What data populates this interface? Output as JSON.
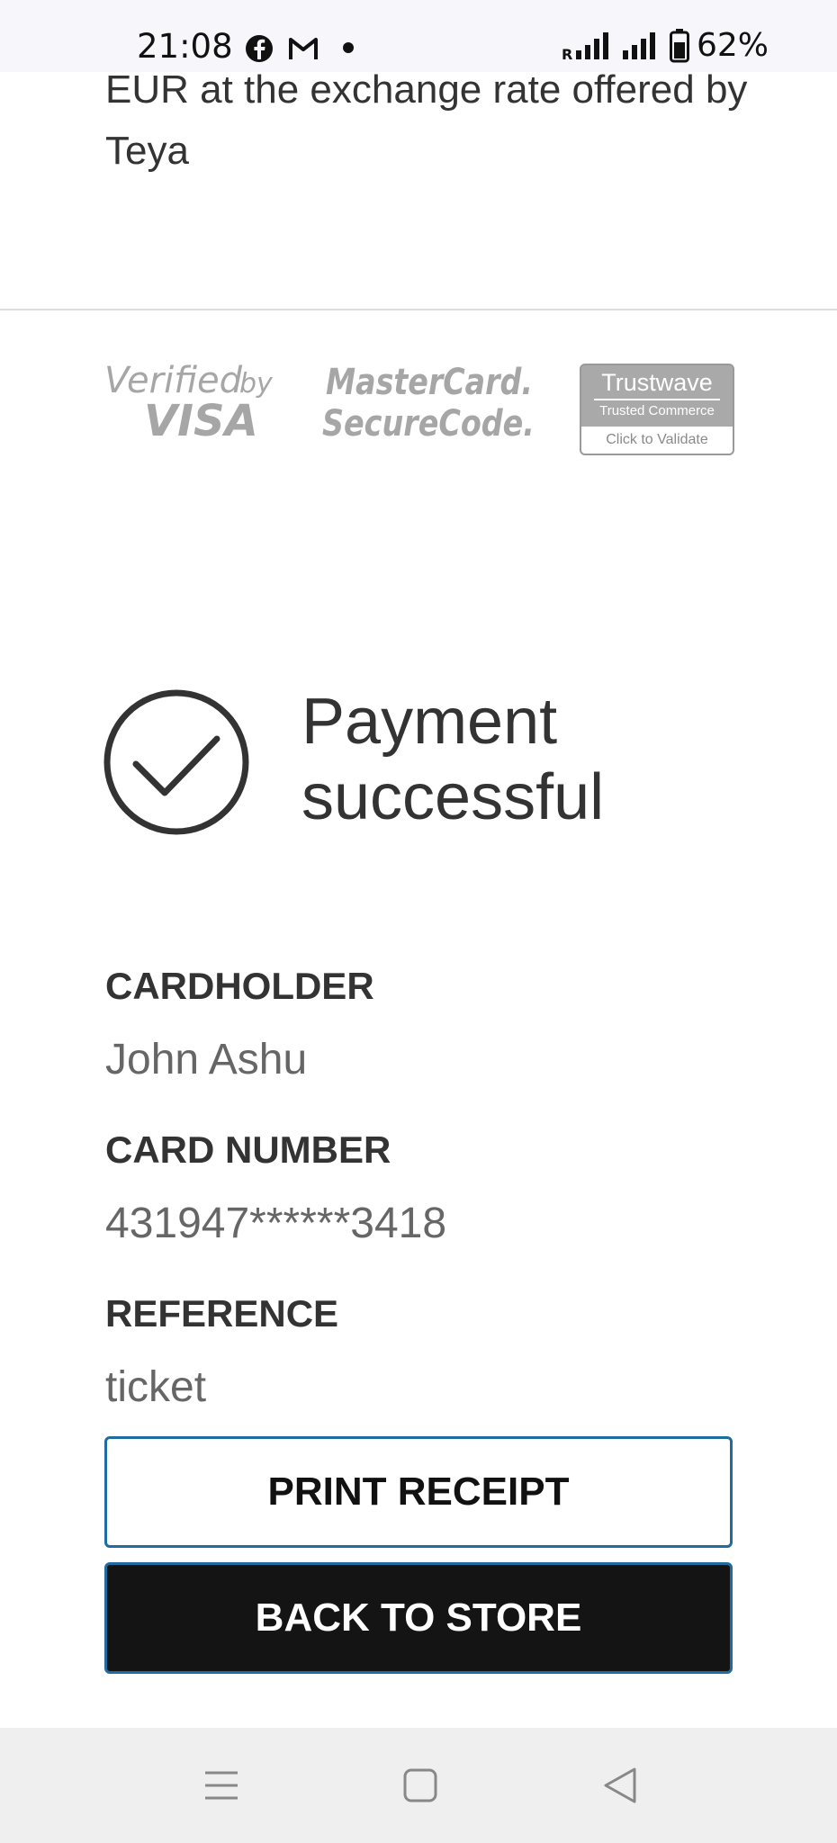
{
  "status_bar": {
    "time": "21:08",
    "battery": "62%",
    "icons": [
      "facebook-icon",
      "gmail-icon",
      "notification-dot-icon",
      "signal-roaming-icon",
      "signal-icon",
      "battery-icon"
    ]
  },
  "info": {
    "exchange_text": "EUR at the exchange rate offered by Teya"
  },
  "security_logos": {
    "visa_line1": "Verified",
    "visa_by": "by",
    "visa_line2": "VISA",
    "mc_line1": "MasterCard.",
    "mc_line2": "SecureCode.",
    "trustwave_brand": "Trustwave",
    "trustwave_sub": "Trusted Commerce",
    "trustwave_validate": "Click to Validate"
  },
  "result": {
    "title": "Payment successful"
  },
  "details": {
    "cardholder_label": "CARDHOLDER",
    "cardholder_value": "John Ashu",
    "card_number_label": "CARD NUMBER",
    "card_number_value": "431947******3418",
    "reference_label": "REFERENCE",
    "reference_value": "ticket"
  },
  "actions": {
    "print_receipt": "PRINT RECEIPT",
    "back_to_store": "BACK TO STORE"
  },
  "nav_bar": {
    "icons": [
      "menu-icon",
      "home-icon",
      "back-icon"
    ]
  },
  "colors": {
    "text_dark": "#333333",
    "text_value": "#666666",
    "button_border": "#1f6da0",
    "button_dark": "#141414",
    "status_bar_bg": "#f6f6fb",
    "nav_bar_bg": "#efefef"
  }
}
